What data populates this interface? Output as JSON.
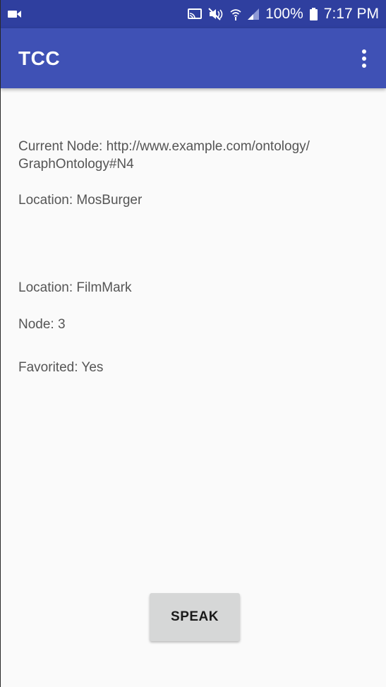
{
  "status_bar": {
    "battery_text": "100%",
    "time": "7:17 PM",
    "icons": [
      "video-camera-icon",
      "cast-icon",
      "mute-icon",
      "wifi-icon",
      "signal-icon",
      "battery-icon"
    ]
  },
  "app_bar": {
    "title": "TCC",
    "overflow_icon": "more-vert-icon"
  },
  "main": {
    "current_node_line1": "Current Node: http://www.example.com/ontology/",
    "current_node_line2": "GraphOntology#N4",
    "location_1": "Location: MosBurger",
    "location_2": "Location: FilmMark",
    "node": "Node: 3",
    "favorited": "Favorited: Yes"
  },
  "actions": {
    "speak_label": "SPEAK"
  },
  "colors": {
    "status_bar": "#2f3f9f",
    "app_bar": "#3f51b5",
    "background": "#fafafa",
    "button": "#d6d7d7"
  }
}
